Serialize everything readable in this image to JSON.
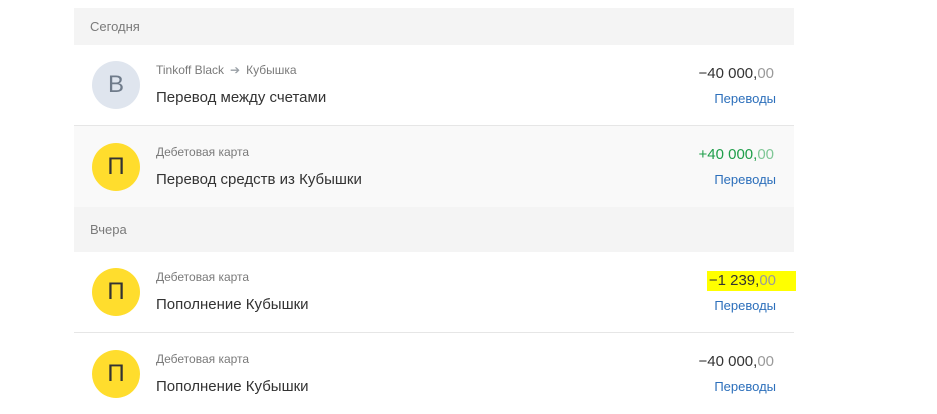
{
  "sections": [
    {
      "header": "Сегодня",
      "operations": [
        {
          "avatar_letter": "В",
          "avatar_color": "#dfe5ee",
          "subtitle_from": "Tinkoff Black",
          "subtitle_to": "Кубышка",
          "title": "Перевод между счетами",
          "amount_main": "−40 000,",
          "amount_cents": "00",
          "category": "Переводы"
        },
        {
          "avatar_letter": "П",
          "avatar_color": "#ffdd2d",
          "subtitle": "Дебетовая карта",
          "title": "Перевод средств из Кубышки",
          "amount_main": "+40 000,",
          "amount_cents": "00",
          "amount_color": "#1f9e4a",
          "category": "Переводы"
        }
      ]
    },
    {
      "header": "Вчера",
      "operations": [
        {
          "avatar_letter": "П",
          "avatar_color": "#ffdd2d",
          "subtitle": "Дебетовая карта",
          "title": "Пополнение Кубышки",
          "amount_main": "−1 239,",
          "amount_cents": "00",
          "amount_highlight": "#ffff00",
          "category": "Переводы"
        },
        {
          "avatar_letter": "П",
          "avatar_color": "#ffdd2d",
          "subtitle": "Дебетовая карта",
          "title": "Пополнение Кубышки",
          "amount_main": "−40 000,",
          "amount_cents": "00",
          "category": "Переводы"
        }
      ]
    }
  ],
  "icons": {
    "transfer_arrow": "arrow-right-icon"
  }
}
